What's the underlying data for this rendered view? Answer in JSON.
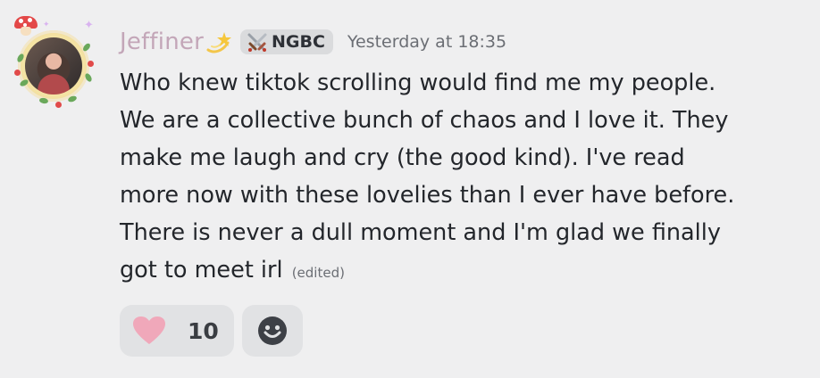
{
  "message": {
    "author": {
      "name": "Jeffiner",
      "name_emoji": "dizzy-star-icon",
      "color": "#c3a6b8"
    },
    "tag": {
      "icon": "crossed-swords-icon",
      "label": "NGBC"
    },
    "timestamp": "Yesterday at 18:35",
    "lines": [
      "Who knew tiktok scrolling would find me my people.",
      "We are a collective bunch of chaos and I love it. They",
      "make me laugh and cry (the good kind). I've read",
      "more now with these lovelies than I ever have before.",
      "There is never a dull moment and I'm glad we finally",
      "got to meet irl"
    ],
    "edited_label": "(edited)",
    "reactions": [
      {
        "emoji": "heart-icon",
        "count": "10",
        "color": "#f0a8ba"
      }
    ],
    "add_reaction_icon": "smiley-face-icon"
  }
}
